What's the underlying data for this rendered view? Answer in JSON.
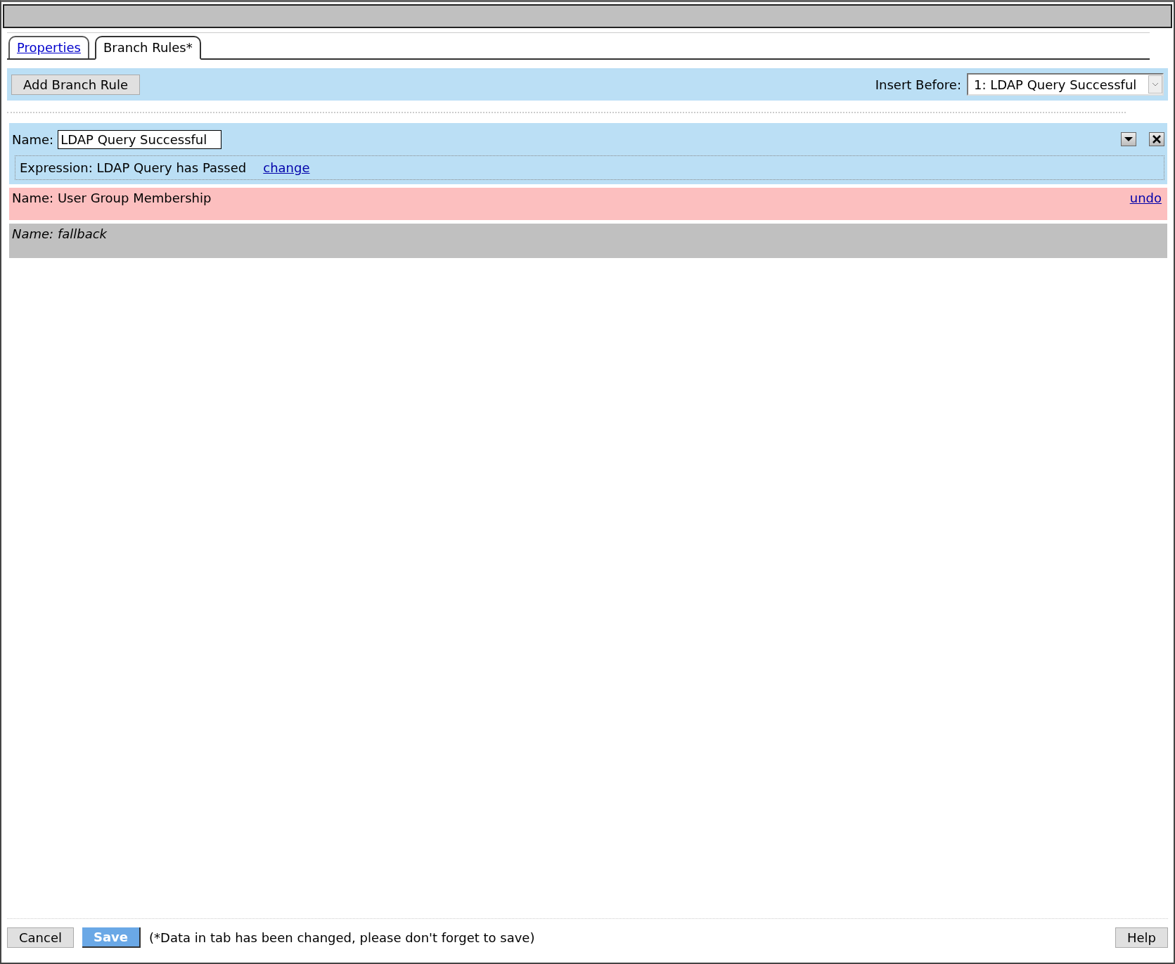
{
  "tabs": [
    {
      "label": "Properties",
      "selected": false
    },
    {
      "label": "Branch Rules*",
      "selected": true
    }
  ],
  "toolbar": {
    "add_button": "Add Branch Rule",
    "insert_label": "Insert Before:",
    "insert_value": "1: LDAP Query Successful"
  },
  "rules": [
    {
      "kind": "edit",
      "name_label": "Name:",
      "name_value": "LDAP Query Successful",
      "expression": "Expression: LDAP Query has Passed",
      "link": "change"
    },
    {
      "kind": "deleted",
      "name": "Name: User Group Membership",
      "link": "undo"
    },
    {
      "kind": "fallback",
      "name": "Name: fallback"
    }
  ],
  "footer": {
    "cancel": "Cancel",
    "save": "Save",
    "note": "(*Data in tab has been changed, please don't forget to save)",
    "help": "Help"
  }
}
